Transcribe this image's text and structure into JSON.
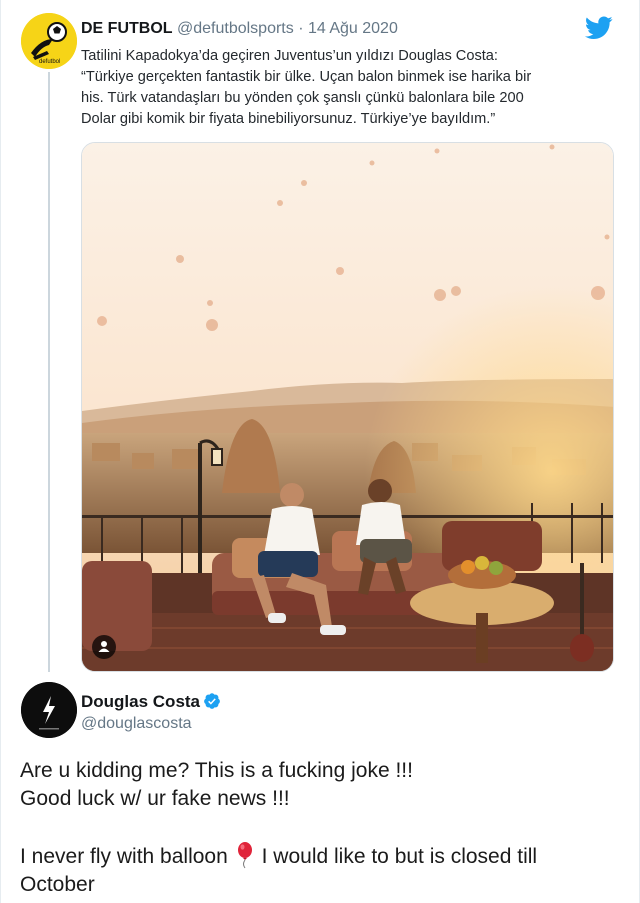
{
  "quoted_tweet": {
    "author_name": "DE FUTBOL",
    "handle": "@defutbolsports",
    "separator": "·",
    "date": "14 Ağu 2020",
    "avatar_icon": "soccer-ball-logo-icon",
    "text_lines": [
      "Tatilini Kapadokya’da geçiren Juventus’un yıldızı Douglas Costa:",
      "“Türkiye gerçekten fantastik bir ülke. Uçan balon binmek ise harika bir",
      "his. Türk vatandaşları bu yönden çok şanslı çünkü balonlara bile 200",
      "Dolar gibi komik bir fiyata binebiliyorsunuz. Türkiye’ye bayıldım.”"
    ],
    "media_icon": "person-tag-icon"
  },
  "reply_tweet": {
    "author_name": "Douglas Costa",
    "handle": "@douglascosta",
    "verified_icon": "verified-badge-icon",
    "avatar_icon": "lightning-bolt-icon",
    "lines": [
      "Are u kidding me? This is a fucking joke !!!",
      "Good luck w/ ur fake news !!!"
    ],
    "line3_before": "I never fly with balloon",
    "line3_emoji": "balloon-icon",
    "line3_after": "I would like to but is closed till",
    "line4": "October"
  },
  "colors": {
    "twitter_blue": "#1da1f2",
    "handle_gray": "#657786",
    "avatar_yellow": "#f5d21a"
  }
}
